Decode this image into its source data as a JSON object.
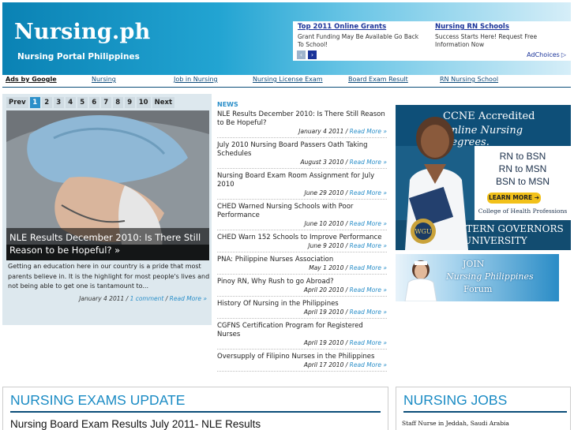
{
  "header": {
    "site_name": "Nursing.ph",
    "tagline": "Nursing Portal Philippines",
    "top_ads": [
      {
        "title": "Top 2011 Online Grants",
        "text": "Grant Funding May Be Available Go Back To School!"
      },
      {
        "title": "Nursing RN Schools",
        "text": "Success Starts Here! Request Free Information Now"
      }
    ],
    "ad_choices": "AdChoices",
    "ad_choices_icon": "triangle-play-icon",
    "prev_arrow": "‹",
    "next_arrow": "›"
  },
  "nav": {
    "ads_by": "Ads by Google",
    "links": [
      "Nursing",
      "Job in Nursing",
      "Nursing License Exam",
      "Board Exam Result",
      "RN Nursing School"
    ]
  },
  "slider": {
    "prev_label": "Prev",
    "pages": [
      "1",
      "2",
      "3",
      "4",
      "5",
      "6",
      "7",
      "8",
      "9",
      "10"
    ],
    "active_page": "1",
    "next_label": "Next",
    "caption": "NLE Results December 2010: Is There Still Reason to be Hopeful? »",
    "excerpt": "Getting an education here in our country is a pride that most parents believe in. It is the highlight for most people's lives and not being able to get one is tantamount to...",
    "date": "January 4 2011",
    "comment_link": "1 comment",
    "read_more": "Read More »"
  },
  "news": {
    "heading": "NEWS",
    "items": [
      {
        "title": "NLE Results December 2010: Is There Still Reason to Be Hopeful?",
        "date": "January 4 2011",
        "more": "Read More »"
      },
      {
        "title": "July 2010 Nursing Board Passers Oath Taking Schedules",
        "date": "August 3 2010",
        "more": "Read More »"
      },
      {
        "title": "Nursing Board Exam Room Assignment for July 2010",
        "date": "June 29 2010",
        "more": "Read More »"
      },
      {
        "title": "CHED Warned Nursing Schools with Poor Performance",
        "date": "June 10 2010",
        "more": "Read More »"
      },
      {
        "title": "CHED Warn 152 Schools to Improve Performance",
        "date": "June 9 2010",
        "more": "Read More »"
      },
      {
        "title": "PNA: Philippine Nurses Association",
        "date": "May 1 2010",
        "more": "Read More »"
      },
      {
        "title": "Pinoy RN, Why Rush to go Abroad?",
        "date": "April 20 2010",
        "more": "Read More »"
      },
      {
        "title": "History Of Nursing in the Philippines",
        "date": "April 19 2010",
        "more": "Read More »"
      },
      {
        "title": "CGFNS Certification Program for Registered Nurses",
        "date": "April 19 2010",
        "more": "Read More »"
      },
      {
        "title": "Oversupply of Filipino Nurses in the Philippines",
        "date": "April 17 2010",
        "more": "Read More »"
      }
    ]
  },
  "wgu_ad": {
    "headline_1": "CCNE Accredited",
    "headline_2": "Online Nursing Degrees.",
    "degrees": [
      "RN to BSN",
      "RN to MSN",
      "BSN to MSN"
    ],
    "button": "LEARN MORE ➔",
    "college": "College of Health Professions",
    "university_line_1": "WESTERN GOVERNORS",
    "university_line_2": "UNIVERSITY",
    "seal_text": "WGU"
  },
  "forum_ad": {
    "line_1": "JOIN",
    "line_2": "Nursing Philippines",
    "line_3": "Forum"
  },
  "exams_box": {
    "heading": "NURSING EXAMS UPDATE",
    "first_item": "Nursing Board Exam Results July 2011- NLE Results"
  },
  "jobs_box": {
    "heading": "NURSING JOBS",
    "first_item": "Staff Nurse in Jeddah, Saudi Arabia"
  }
}
